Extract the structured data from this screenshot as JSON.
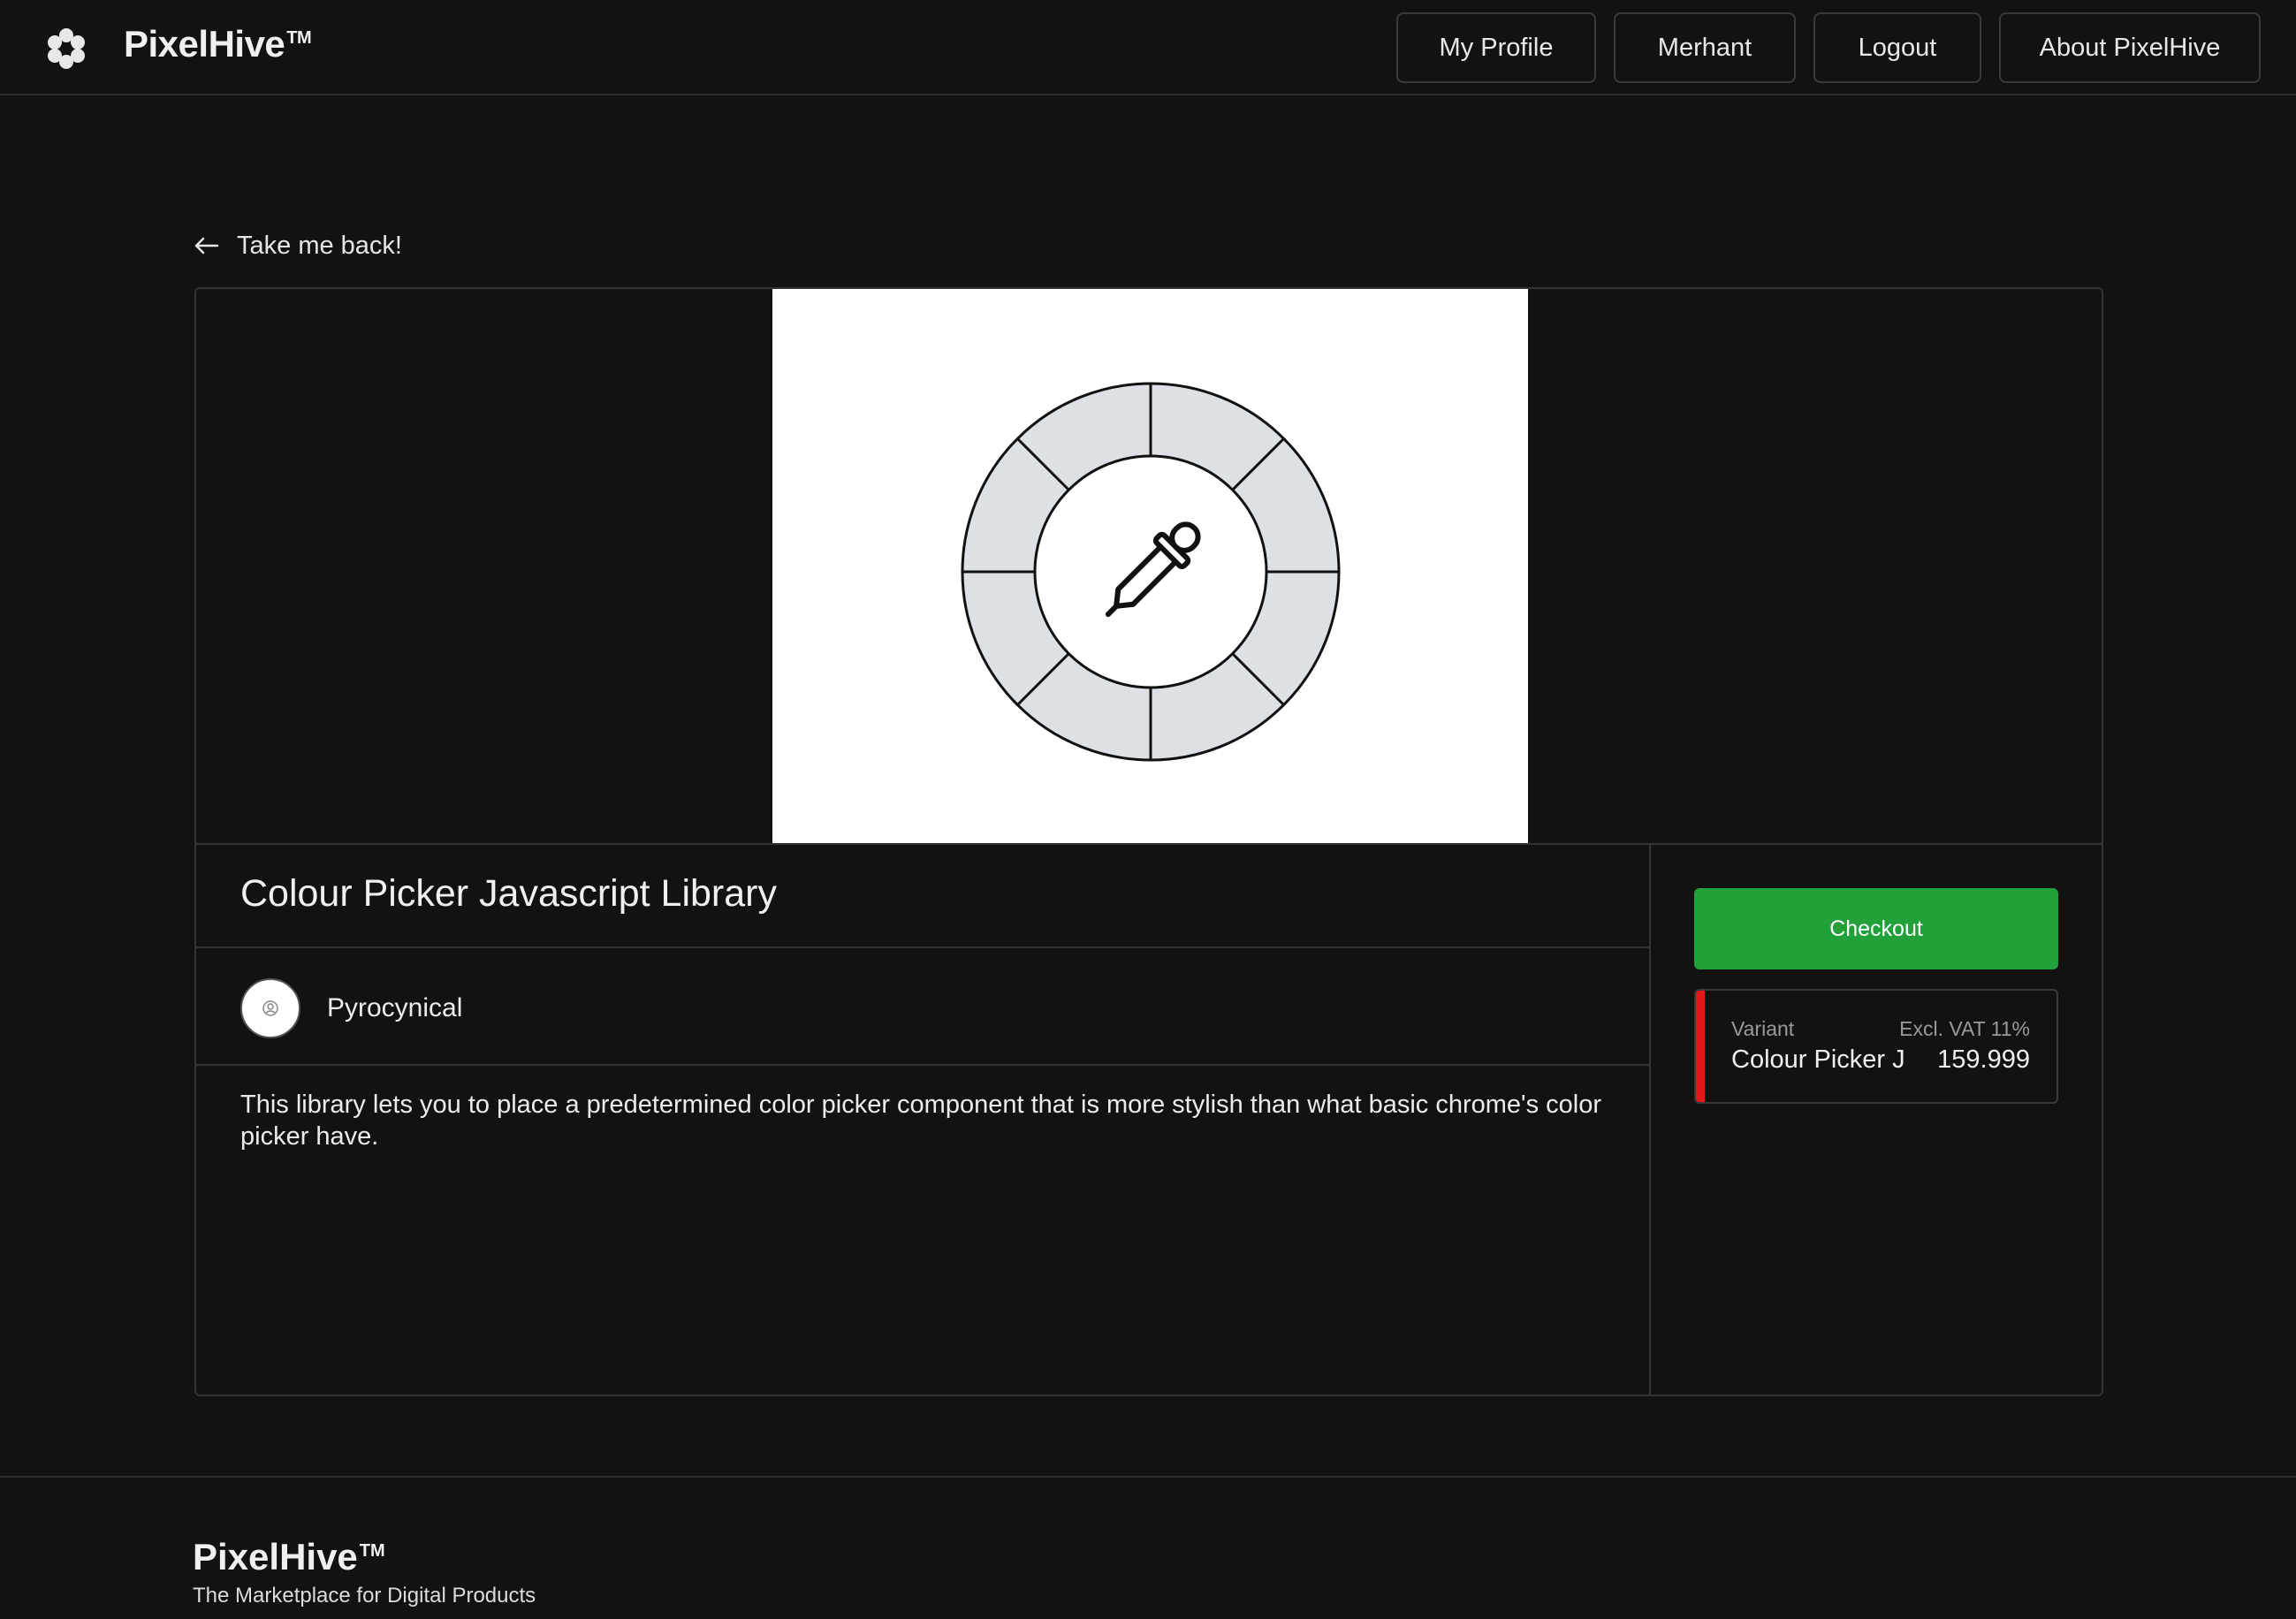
{
  "header": {
    "brand": "PixelHive",
    "trademark": "TM",
    "nav": [
      "My Profile",
      "Merhant",
      "Logout",
      "About PixelHive"
    ]
  },
  "back_link": "Take me back!",
  "product": {
    "title": "Colour Picker Javascript Library",
    "seller": "Pyrocynical",
    "description": "This library lets you to place a predetermined color picker component that is more stylish than what basic chrome's color picker have.",
    "image_icon": "color-wheel-eyedropper-icon"
  },
  "purchase": {
    "checkout_label": "Checkout",
    "variant_label": "Variant",
    "vat_label": "Excl. VAT 11%",
    "variant_name": "Colour Picker J",
    "price": "159.999"
  },
  "footer": {
    "brand": "PixelHive",
    "trademark": "TM",
    "tagline": "The Marketplace for Digital Products"
  },
  "colors": {
    "background": "#121212",
    "checkout": "#22a03a",
    "variant_accent": "#e01818"
  }
}
